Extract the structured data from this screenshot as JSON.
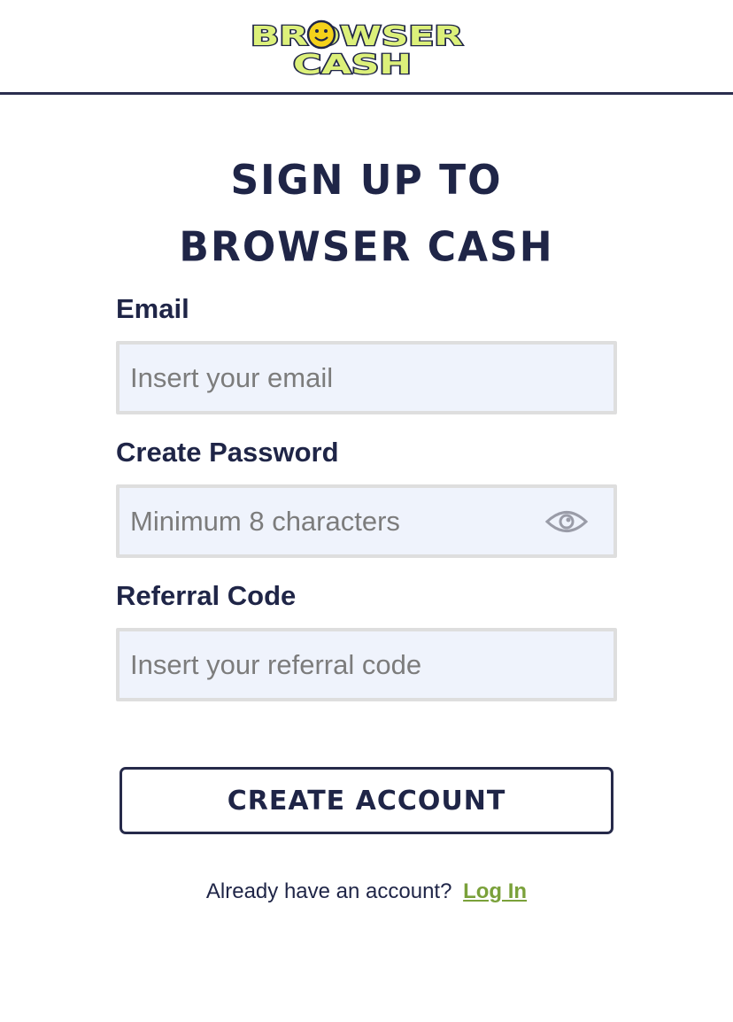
{
  "header": {
    "logo_line1": "BROWSER",
    "logo_line2": "CASH",
    "logo_icon": "smiley-face-icon",
    "colors": {
      "logo_fill": "#dcf07a",
      "logo_stroke": "#1f2547",
      "smiley": "#f5d21a"
    }
  },
  "page": {
    "title_line1": "SIGN UP TO",
    "title_line2": "BROWSER CASH"
  },
  "form": {
    "email_label": "Email",
    "email_placeholder": "Insert your email",
    "email_value": "",
    "password_label": "Create Password",
    "password_placeholder": "Minimum 8 characters",
    "password_value": "",
    "password_toggle_icon": "eye-icon",
    "referral_label": "Referral Code",
    "referral_placeholder": "Insert your referral code",
    "referral_value": "",
    "submit_label": "CREATE ACCOUNT"
  },
  "footer": {
    "prompt_text": "Already have an account?",
    "login_link": "Log In",
    "colors": {
      "link": "#7aa13a"
    }
  }
}
